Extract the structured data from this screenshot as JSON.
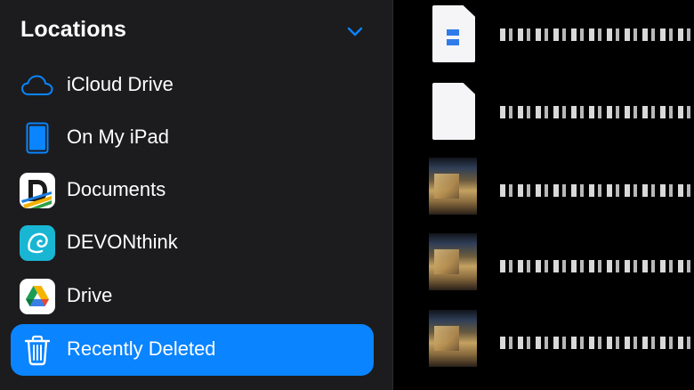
{
  "sidebar": {
    "section_title": "Locations",
    "accent_color": "#0a84ff",
    "items": [
      {
        "label": "iCloud Drive",
        "icon": "cloud-icon"
      },
      {
        "label": "On My iPad",
        "icon": "ipad-icon"
      },
      {
        "label": "Documents",
        "icon": "documents-app-icon"
      },
      {
        "label": "DEVONthink",
        "icon": "devonthink-app-icon"
      },
      {
        "label": "Drive",
        "icon": "google-drive-icon"
      },
      {
        "label": "Recently Deleted",
        "icon": "trash-icon",
        "selected": true
      }
    ]
  },
  "content": {
    "files": [
      {
        "thumbnail": "document-with-blue-marks-icon"
      },
      {
        "thumbnail": "blank-document-icon"
      },
      {
        "thumbnail": "photo-thumbnail"
      },
      {
        "thumbnail": "photo-thumbnail"
      },
      {
        "thumbnail": "photo-thumbnail"
      }
    ]
  }
}
